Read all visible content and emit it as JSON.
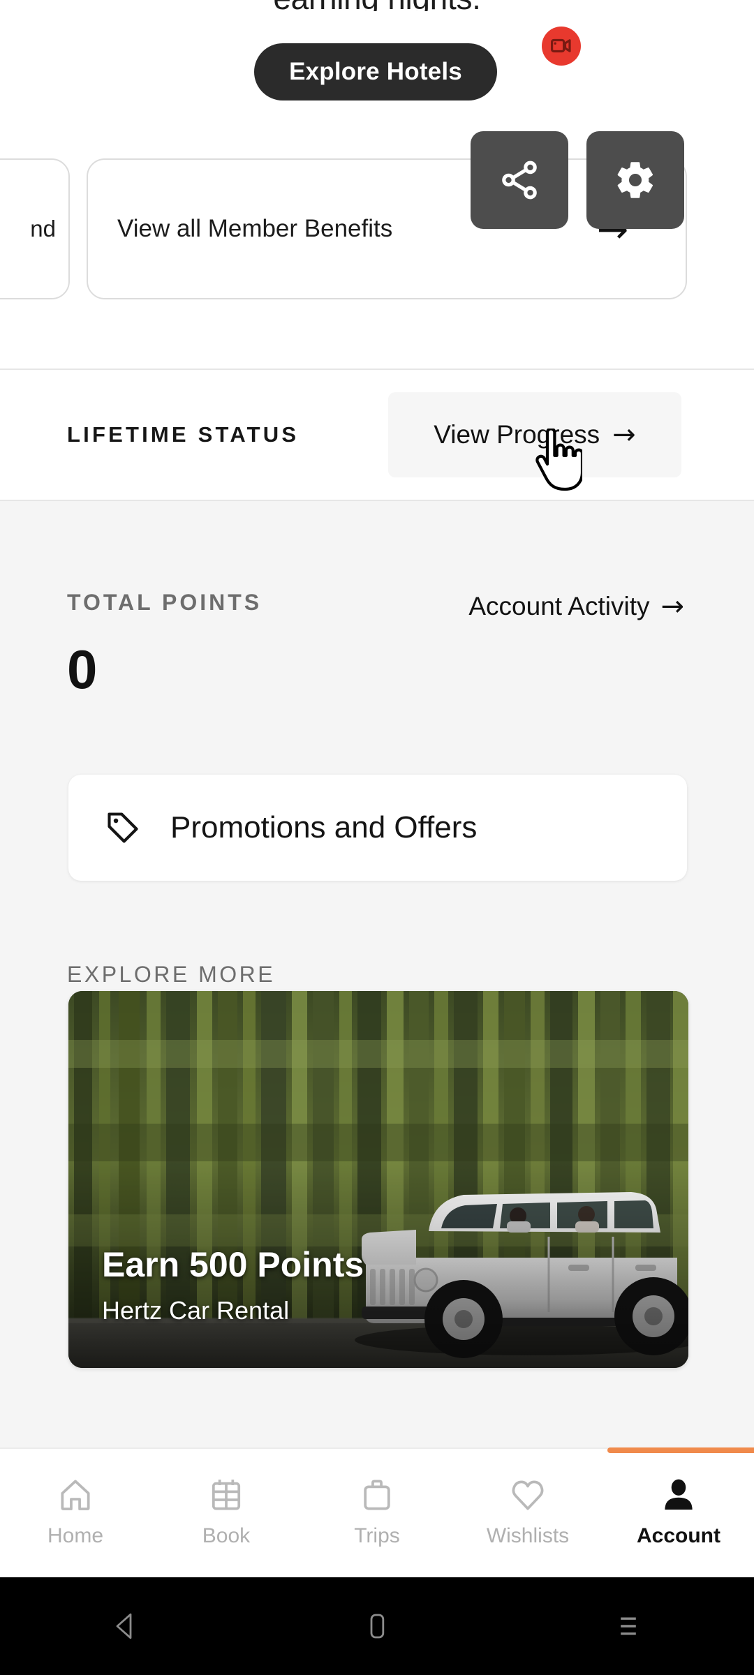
{
  "app": {
    "partial_heading_top": "earning nights.",
    "explore_hotels_label": "Explore Hotels"
  },
  "status_overlay": {
    "recording_icon": "video-camera-icon"
  },
  "benefits_carousel": {
    "partial_card_label": "nd",
    "benefits_card_label": "View all Member Benefits",
    "arrow_glyph": "→"
  },
  "floating_tools": {
    "share_icon": "share-icon",
    "settings_icon": "gear-icon"
  },
  "lifetime_status": {
    "section_label": "LIFETIME STATUS",
    "view_progress_label": "View Progress",
    "arrow_glyph": "→"
  },
  "points": {
    "total_points_label": "TOTAL POINTS",
    "total_points_value": "0",
    "account_activity_label": "Account Activity",
    "arrow_glyph": "→"
  },
  "promotions": {
    "icon": "tag-icon",
    "label": "Promotions and Offers"
  },
  "explore_more": {
    "section_label": "EXPLORE MORE",
    "cards": [
      {
        "title": "Earn 500 Points",
        "subtitle": "Hertz Car Rental",
        "image": "white-jeep-driving-forest-road"
      }
    ]
  },
  "tabbar": {
    "items": [
      {
        "label": "Home",
        "icon": "home-icon",
        "active": false
      },
      {
        "label": "Book",
        "icon": "calendar-icon",
        "active": false
      },
      {
        "label": "Trips",
        "icon": "suitcase-icon",
        "active": false
      },
      {
        "label": "Wishlists",
        "icon": "heart-icon",
        "active": false
      },
      {
        "label": "Account",
        "icon": "person-icon",
        "active": true
      }
    ],
    "active_indicator_color": "#f08a4b",
    "inactive_color": "#b0b0b0",
    "active_color": "#111111"
  },
  "android_nav": {
    "back_icon": "triangle-back-icon",
    "home_icon": "rounded-square-home-icon",
    "recents_icon": "hamburger-recents-icon"
  },
  "colors": {
    "page_background": "#ffffff",
    "body_background": "#f5f5f5",
    "primary_button": "#2b2b2b",
    "tool_button": "#4d4d4d",
    "recording_badge": "#e8392e",
    "accent_orange": "#f08a4b"
  }
}
